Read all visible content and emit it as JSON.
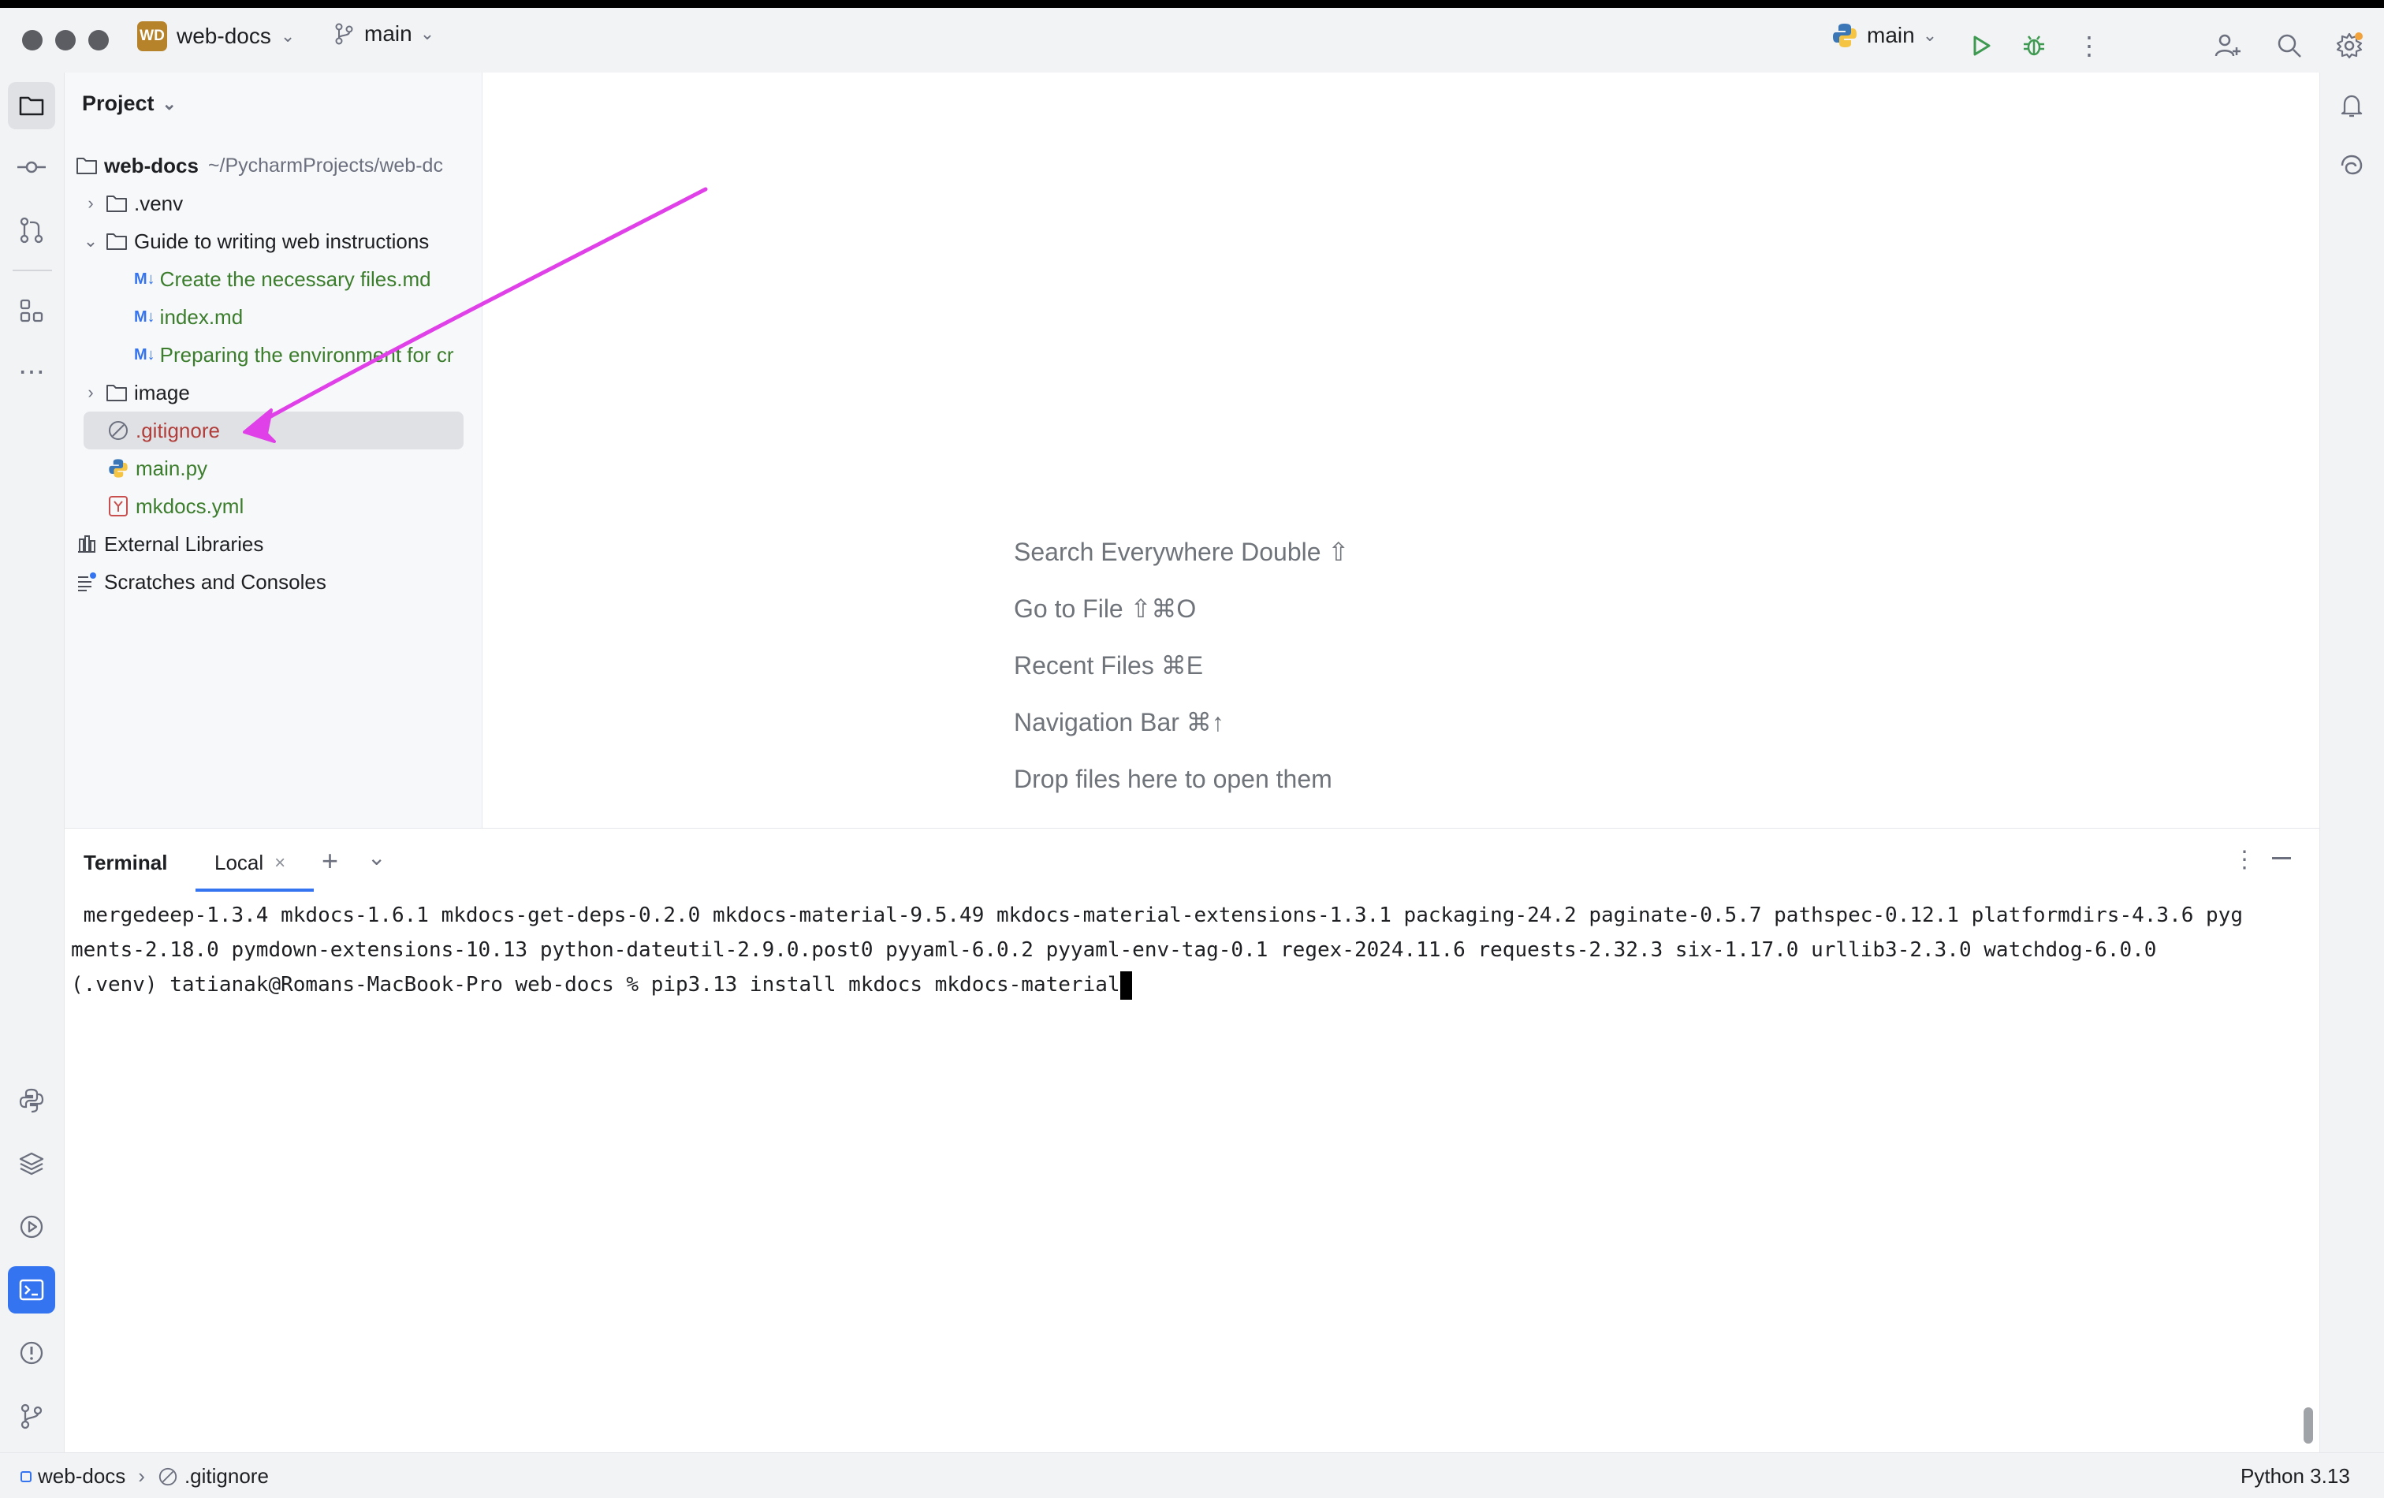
{
  "topbar": {
    "project_badge": "WD",
    "project_name": "web-docs",
    "branch": "main",
    "run_config": "main"
  },
  "project_panel": {
    "title": "Project",
    "tree": [
      {
        "label": "web-docs",
        "path": "~/PycharmProjects/web-dc"
      },
      {
        "label": ".venv"
      },
      {
        "label": "Guide to writing web instructions"
      },
      {
        "label": "Create the necessary files.md"
      },
      {
        "label": "index.md"
      },
      {
        "label": "Preparing the environment for cr"
      },
      {
        "label": "image"
      },
      {
        "label": ".gitignore"
      },
      {
        "label": "main.py"
      },
      {
        "label": "mkdocs.yml"
      },
      {
        "label": "External Libraries"
      },
      {
        "label": "Scratches and Consoles"
      }
    ],
    "selected": ".gitignore"
  },
  "editor": {
    "hints": [
      "Search Everywhere Double ⇧",
      "Go to File ⇧⌘O",
      "Recent Files ⌘E",
      "Navigation Bar ⌘↑",
      "Drop files here to open them"
    ]
  },
  "terminal": {
    "title": "Terminal",
    "tab": "Local",
    "lines": [
      " mergedeep-1.3.4 mkdocs-1.6.1 mkdocs-get-deps-0.2.0 mkdocs-material-9.5.49 mkdocs-material-extensions-1.3.1 packaging-24.2 paginate-0.5.7 pathspec-0.12.1 platformdirs-4.3.6 pyg",
      "ments-2.18.0 pymdown-extensions-10.13 python-dateutil-2.9.0.post0 pyyaml-6.0.2 pyyaml-env-tag-0.1 regex-2024.11.6 requests-2.32.3 six-1.17.0 urllib3-2.3.0 watchdog-6.0.0",
      "(.venv) tatianak@Romans-MacBook-Pro web-docs % pip3.13 install mkdocs mkdocs-material"
    ]
  },
  "statusbar": {
    "project": "web-docs",
    "file": ".gitignore",
    "interpreter": "Python 3.13"
  },
  "annotation": {
    "color": "#e040e8"
  },
  "colors": {
    "accent": "#3574f0",
    "vcs_added": "#3b7d2c",
    "vcs_ignored": "#b13d3a"
  }
}
